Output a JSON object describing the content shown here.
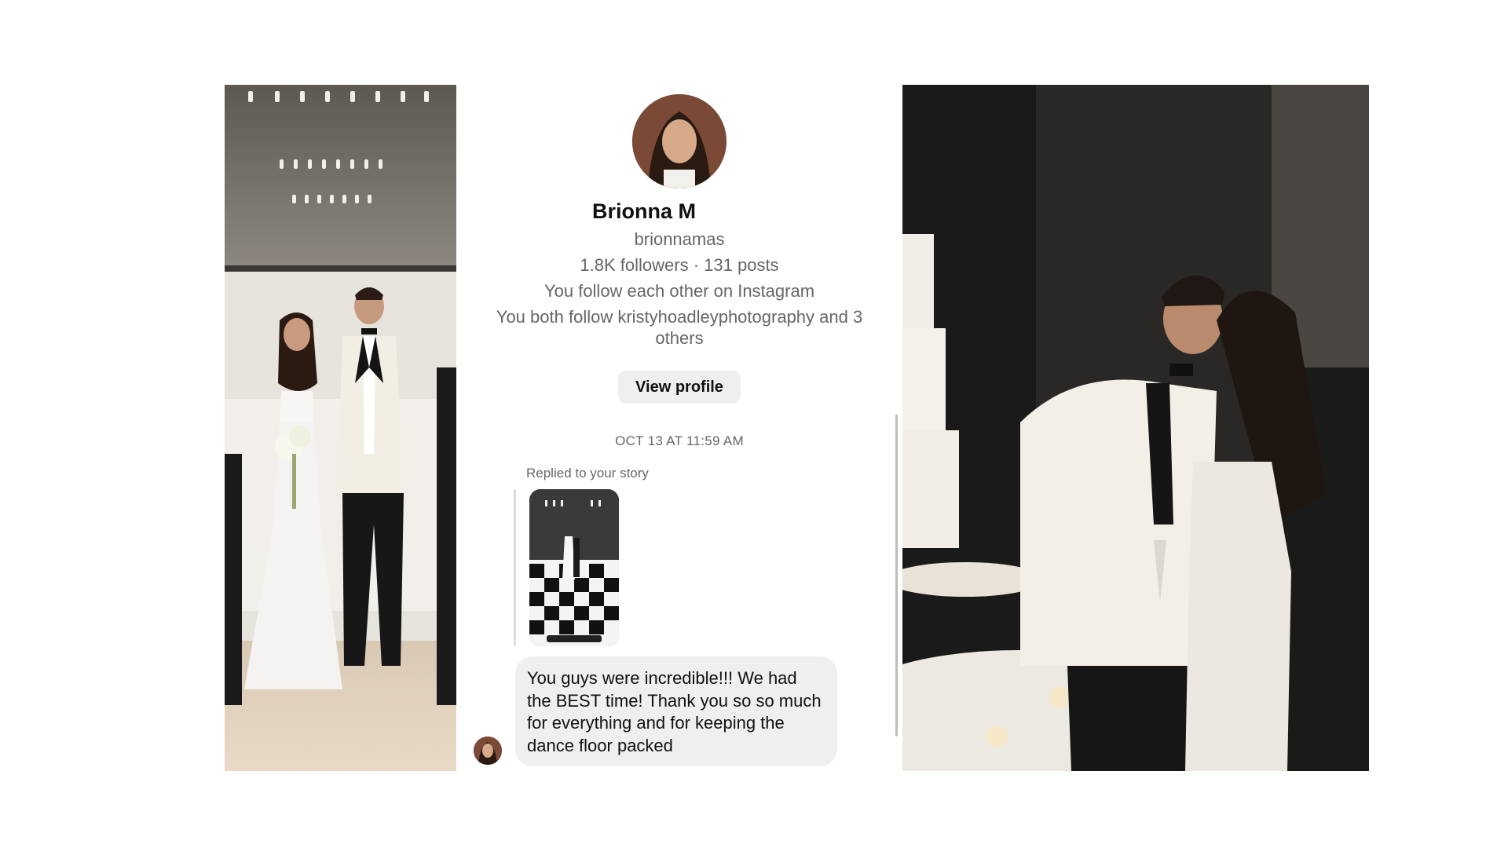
{
  "profile": {
    "name": "Brionna M",
    "handle": "brionnamas",
    "stats": "1.8K followers · 131 posts",
    "mutual_status": "You follow each other on Instagram",
    "mutual_follows": "You both follow kristyhoadleyphotography and 3 others",
    "view_profile_label": "View profile"
  },
  "conversation": {
    "timestamp": "OCT 13 AT 11:59 AM",
    "replied_label": "Replied to your story",
    "message": "You guys were incredible!!! We had the BEST time! Thank you so so much for everything and for keeping the dance floor packed"
  },
  "photos": {
    "left": "wedding-couple-portrait",
    "right": "wedding-couple-kiss-cake"
  },
  "colors": {
    "bubble": "#efefef",
    "secondary_text": "#666666",
    "button_bg": "#efefef"
  }
}
